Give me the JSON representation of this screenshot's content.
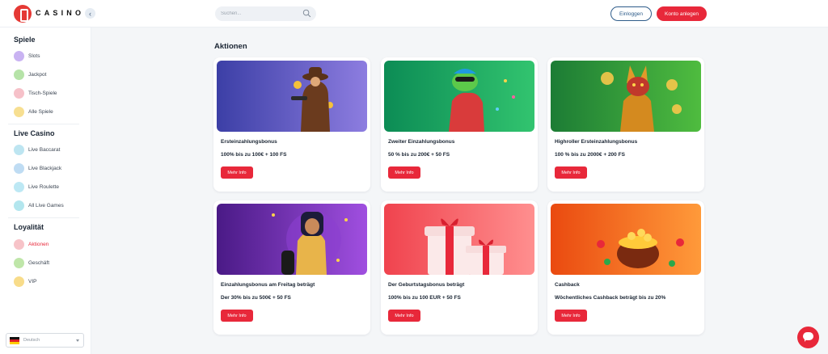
{
  "header": {
    "logo_text": "CASINO",
    "search_placeholder": "Suchen...",
    "login_label": "Einloggen",
    "register_label": "Konto anlegen",
    "accent_color": "#e8283a"
  },
  "sidebar": {
    "sections": [
      {
        "title": "Spiele",
        "items": [
          {
            "label": "Slots",
            "icon": "slots-icon",
            "color": "#c9b3f2"
          },
          {
            "label": "Jackpot",
            "icon": "jackpot-icon",
            "color": "#b6e3a8"
          },
          {
            "label": "Tisch-Spiele",
            "icon": "table-games-icon",
            "color": "#f6c1c9"
          },
          {
            "label": "Alle Spiele",
            "icon": "all-games-icon",
            "color": "#f7df91"
          }
        ]
      },
      {
        "title": "Live Casino",
        "items": [
          {
            "label": "Live Baccarat",
            "icon": "baccarat-icon",
            "color": "#bde5f1"
          },
          {
            "label": "Live Blackjack",
            "icon": "blackjack-icon",
            "color": "#bfdcf3"
          },
          {
            "label": "Live Roulette",
            "icon": "roulette-icon",
            "color": "#bde8f4"
          },
          {
            "label": "All Live Games",
            "icon": "live-games-icon",
            "color": "#b3e6ee"
          }
        ]
      },
      {
        "title": "Loyalität",
        "items": [
          {
            "label": "Aktionen",
            "icon": "promotions-icon",
            "color": "#f7c3c8",
            "active": true
          },
          {
            "label": "Geschäft",
            "icon": "shop-icon",
            "color": "#bfe6a9"
          },
          {
            "label": "VIP",
            "icon": "vip-icon",
            "color": "#f8dc8a"
          }
        ]
      }
    ],
    "language": "Deutsch"
  },
  "main": {
    "title": "Aktionen",
    "button_label": "Mehr Info",
    "promos": [
      {
        "title": "Ersteinzahlungsbonus",
        "desc": "100% bis zu 100€ + 100 FS",
        "bg1": "#3c3fa6",
        "bg2": "#8d7de0"
      },
      {
        "title": "Zweiter Einzahlungsbonus",
        "desc": "50 % bis zu 200€ + 50 FS",
        "bg1": "#0c8c55",
        "bg2": "#32c46f"
      },
      {
        "title": "Highroller Ersteinzahlungsbonus",
        "desc": "100 % bis zu 2000€ + 200 FS",
        "bg1": "#1c7c35",
        "bg2": "#4fbc3f"
      },
      {
        "title": "Einzahlungsbonus am Freitag beträgt",
        "desc": "Der 30% bis zu 500€ + 50 FS",
        "bg1": "#4a1a86",
        "bg2": "#a04fe0"
      },
      {
        "title": "Der Geburtstagsbonus beträgt",
        "desc": "100% bis zu 100 EUR + 50 FS",
        "bg1": "#f0434e",
        "bg2": "#ff8f8f"
      },
      {
        "title": "Cashback",
        "desc": "Wöchentliches Cashback beträgt bis zu 20%",
        "bg1": "#ea4a10",
        "bg2": "#ff9a3a"
      }
    ]
  }
}
